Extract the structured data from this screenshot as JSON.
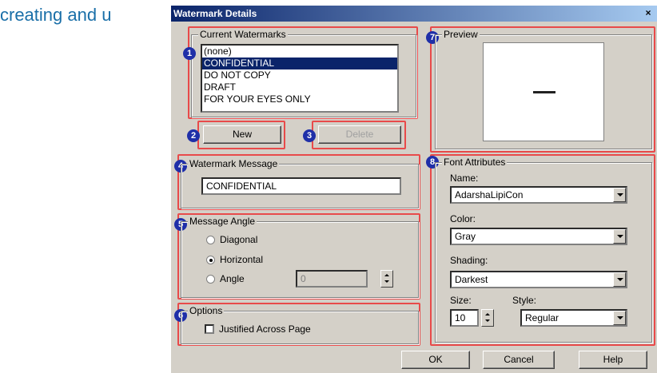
{
  "background_text": "creating and u",
  "dialog": {
    "title": "Watermark Details",
    "close_label": "×"
  },
  "badges": [
    "1",
    "2",
    "3",
    "4",
    "5",
    "6",
    "7",
    "8"
  ],
  "current_watermarks": {
    "group_title": "Current Watermarks",
    "items": [
      "(none)",
      "CONFIDENTIAL",
      "DO NOT COPY",
      "DRAFT",
      "FOR YOUR EYES ONLY"
    ],
    "selected_index": 1
  },
  "buttons": {
    "new": "New",
    "delete": "Delete",
    "ok": "OK",
    "cancel": "Cancel",
    "help": "Help"
  },
  "watermark_message": {
    "group_title": "Watermark Message",
    "value": "CONFIDENTIAL"
  },
  "message_angle": {
    "group_title": "Message Angle",
    "options": [
      "Diagonal",
      "Horizontal",
      "Angle"
    ],
    "selected": "Horizontal",
    "angle_value": "0"
  },
  "options": {
    "group_title": "Options",
    "justified_label": "Justified Across Page",
    "justified_checked": false
  },
  "preview": {
    "group_title": "Preview"
  },
  "font_attributes": {
    "group_title": "Font Attributes",
    "name_label": "Name:",
    "name_value": "AdarshaLipiCon",
    "color_label": "Color:",
    "color_value": "Gray",
    "shading_label": "Shading:",
    "shading_value": "Darkest",
    "size_label": "Size:",
    "size_value": "10",
    "style_label": "Style:",
    "style_value": "Regular"
  },
  "colors": {
    "highlight": "#e84a4a",
    "badge": "#1f2fa8",
    "selection": "#0a246a"
  }
}
